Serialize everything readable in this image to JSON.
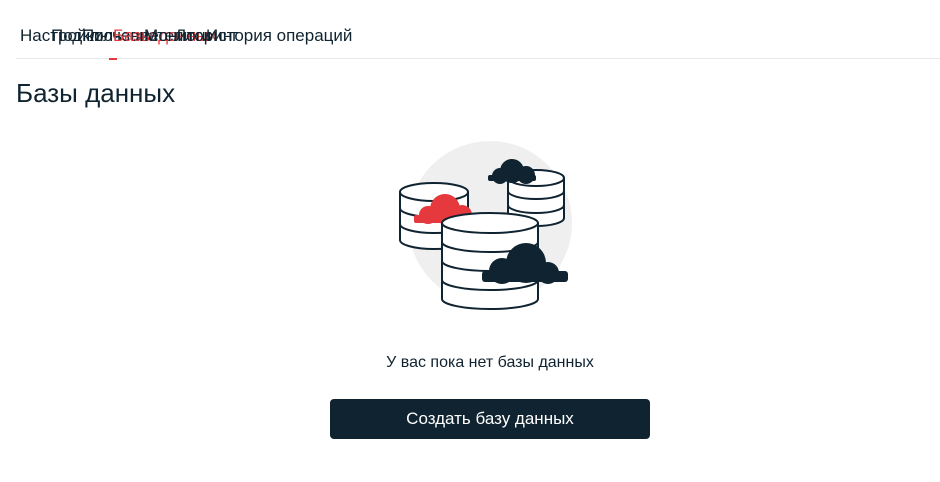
{
  "tabs": [
    {
      "label": "Настройки",
      "active": false
    },
    {
      "label": "Подключение",
      "active": false
    },
    {
      "label": "Пользователи",
      "active": false
    },
    {
      "label": "Базы данных",
      "active": true
    },
    {
      "label": "Мониторинг",
      "active": false
    },
    {
      "label": "Логи",
      "active": false
    },
    {
      "label": "История операций",
      "active": false
    }
  ],
  "page": {
    "title": "Базы данных",
    "empty_state_text": "У вас пока нет базы данных",
    "create_button_label": "Создать базу данных",
    "illustration_icon": "database-cloud-icon"
  },
  "colors": {
    "accent": "#e5393d",
    "primary_dark": "#0f2330",
    "divider": "#e6e8ea",
    "illustration_bg": "#efefef"
  }
}
